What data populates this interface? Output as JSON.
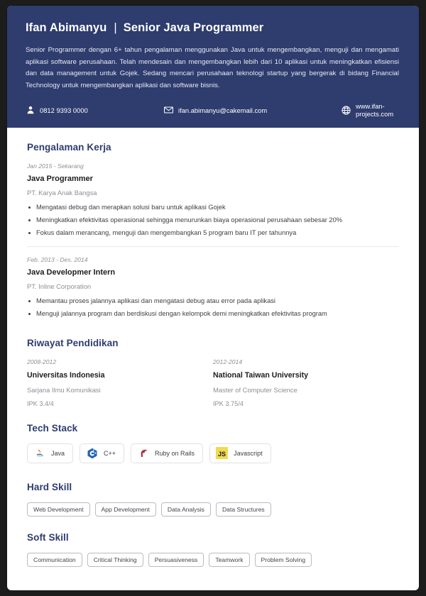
{
  "header": {
    "name": "Ifan Abimanyu",
    "separator": "|",
    "role": "Senior Java Programmer",
    "summary": "Senior Programmer dengan 6+ tahun pengalaman menggunakan Java untuk mengembangkan, menguji dan mengamati aplikasi software perusahaan. Telah mendesain dan mengembangkan lebih dari 10 aplikasi untuk meningkatkan efisiensi dan data management untuk Gojek. Sedang mencari perusahaan teknologi startup yang bergerak di bidang Financial Technology untuk mengembangkan aplikasi dan software bisnis.",
    "background_color": "#2e3c6e",
    "contacts": [
      {
        "icon": "person-icon",
        "value": "0812 9393 0000"
      },
      {
        "icon": "envelope-icon",
        "value": "ifan.abimanyu@cakemail.com"
      },
      {
        "icon": "globe-icon",
        "value": "www.ifan-projects.com"
      }
    ]
  },
  "experience": {
    "title": "Pengalaman Kerja",
    "entries": [
      {
        "date": "Jan 2015 - Sekarang",
        "role": "Java Programmer",
        "company": "PT. Karya Anak Bangsa",
        "bullets": [
          "Mengatasi debug dan merapkan solusi baru untuk aplikasi Gojek",
          "Meningkatkan efektivitas operasional sehingga menurunkan biaya operasional perusahaan sebesar 20%",
          "Fokus dalam merancang, menguji dan mengembangkan 5 program baru IT per tahunnya"
        ]
      },
      {
        "date": "Feb. 2013 - Des. 2014",
        "role": "Java Developmer Intern",
        "company": "PT. Inline Corporation",
        "bullets": [
          "Memantau proses jalannya aplikasi dan mengatasi debug atau error pada aplikasi",
          "Menguji jalannya program dan berdiskusi dengan kelompok demi meningkatkan efektivitas program"
        ]
      }
    ]
  },
  "education": {
    "title": "Riwayat Pendidikan",
    "entries": [
      {
        "date": "2008-2012",
        "school": "Universitas Indonesia",
        "degree": "Sarjana Ilmu Komunikasi",
        "gpa": "IPK 3.4/4"
      },
      {
        "date": "2012-2014",
        "school": "National Taiwan University",
        "degree": "Master of Computer Science",
        "gpa": "IPK 3.75/4"
      }
    ]
  },
  "tech_stack": {
    "title": "Tech Stack",
    "items": [
      {
        "label": "Java",
        "icon": "java-logo-icon",
        "color": "#e76f00"
      },
      {
        "label": "C++",
        "icon": "cplusplus-logo-icon",
        "color": "#2264b5"
      },
      {
        "label": "Ruby on Rails",
        "icon": "rails-logo-icon",
        "color": "#a32638"
      },
      {
        "label": "Javascript",
        "icon": "javascript-logo-icon",
        "color": "#eedb4e"
      }
    ]
  },
  "hard_skill": {
    "title": "Hard Skill",
    "items": [
      "Web Development",
      "App Development",
      "Data Analysis",
      "Data Structures"
    ]
  },
  "soft_skill": {
    "title": "Soft Skill",
    "items": [
      "Communication",
      "Critical Thinking",
      "Persuasiveness",
      "Teamwork",
      "Problem Solving"
    ]
  }
}
